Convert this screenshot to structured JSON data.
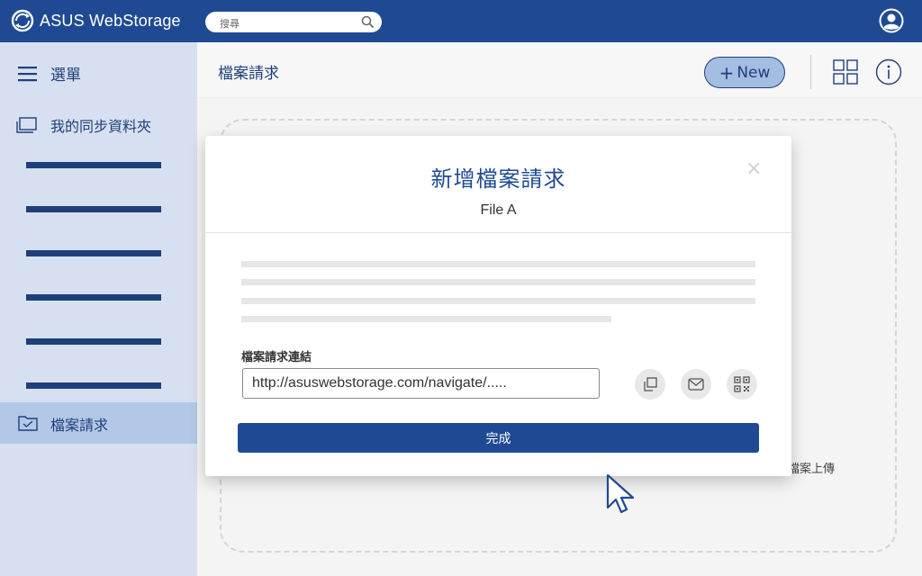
{
  "app": {
    "title": "ASUS WebStorage"
  },
  "search": {
    "placeholder": "搜尋"
  },
  "sidebar": {
    "menu_label": "選單",
    "sync_label": "我的同步資料夾",
    "file_request_label": "檔案請求"
  },
  "header": {
    "title": "檔案請求",
    "new_label": "New",
    "new_plus": "+"
  },
  "dropzone": {
    "text": "檔案上傳"
  },
  "modal": {
    "title": "新增檔案請求",
    "subtitle": "File A",
    "close": "×",
    "link_label": "檔案請求連結",
    "link_value": "http://asuswebstorage.com/navigate/.....",
    "done_label": "完成"
  },
  "colors": {
    "brand_blue": "#1f4a93",
    "sidebar_bg": "#d6e0f0",
    "sidebar_active": "#b3c8e6",
    "new_button": "#a3bde3"
  },
  "icons": [
    "asus-logo-icon",
    "search-icon",
    "user-icon",
    "hamburger-icon",
    "sync-folder-icon",
    "folder-check-icon",
    "grid-view-icon",
    "info-icon",
    "close-icon",
    "copy-icon",
    "mail-icon",
    "qr-code-icon",
    "cursor-icon"
  ]
}
